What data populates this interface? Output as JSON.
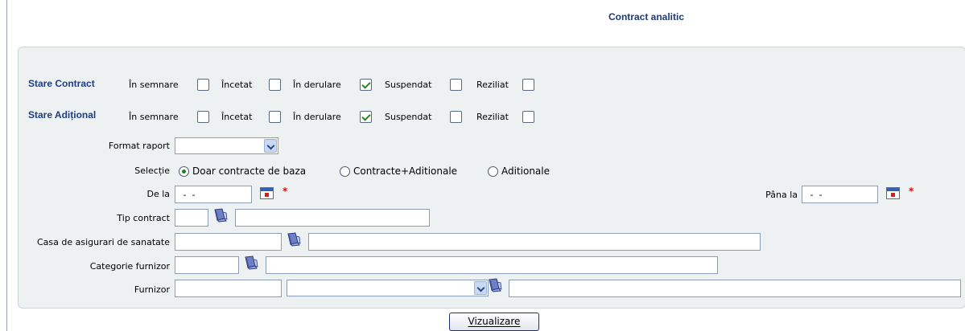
{
  "title": "Contract analitic",
  "stare_contract": {
    "label": "Stare Contract",
    "options": [
      {
        "label": "În semnare",
        "checked": false
      },
      {
        "label": "Încetat",
        "checked": false
      },
      {
        "label": "În derulare",
        "checked": true
      },
      {
        "label": "Suspendat",
        "checked": false
      },
      {
        "label": "Reziliat",
        "checked": false
      }
    ]
  },
  "stare_aditional": {
    "label": "Stare Adițional",
    "options": [
      {
        "label": "În semnare",
        "checked": false
      },
      {
        "label": "Încetat",
        "checked": false
      },
      {
        "label": "În derulare",
        "checked": true
      },
      {
        "label": "Suspendat",
        "checked": false
      },
      {
        "label": "Reziliat",
        "checked": false
      }
    ]
  },
  "format_raport": {
    "label": "Format raport",
    "value": ""
  },
  "selectie": {
    "label": "Selecție",
    "options": [
      {
        "label": "Doar contracte de baza",
        "selected": true
      },
      {
        "label": "Contracte+Aditionale",
        "selected": false
      },
      {
        "label": "Aditionale",
        "selected": false
      }
    ]
  },
  "de_la": {
    "label": "De la",
    "value": " -  - ",
    "required_mark": "*"
  },
  "pana_la": {
    "label": "Pâna la",
    "value": " -  - ",
    "required_mark": "*"
  },
  "tip_contract": {
    "label": "Tip contract",
    "code": "",
    "name": ""
  },
  "casa": {
    "label": "Casa de asigurari de sanatate",
    "code": "",
    "name": ""
  },
  "categorie": {
    "label": "Categorie furnizor",
    "code": "",
    "name": ""
  },
  "furnizor": {
    "label": "Furnizor",
    "code": "",
    "select_value": "",
    "name": ""
  },
  "submit_label": "Vizualizare",
  "icons": {
    "calendar": "calendar-icon",
    "lookup": "lookup-book-icon",
    "dropdown": "chevron-down-icon"
  }
}
